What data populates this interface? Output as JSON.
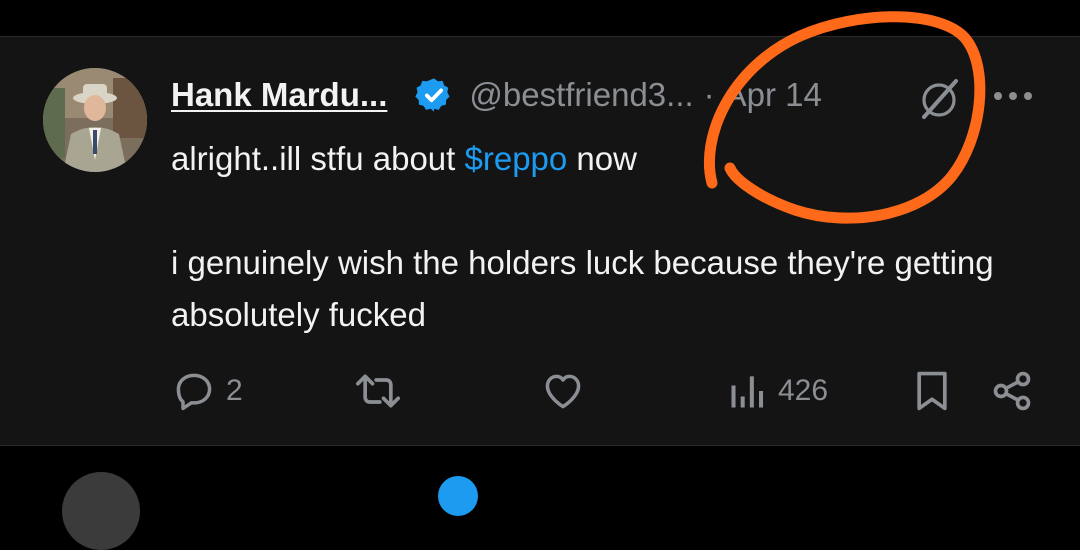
{
  "tweet": {
    "author_name": "Hank Mardu...",
    "handle": "@bestfriend3...",
    "separator": "·",
    "date": "Apr 14",
    "body_line1_prefix": "alright..ill stfu about ",
    "cashtag": "$reppo",
    "body_line1_suffix": " now",
    "body_line2": "i genuinely wish the holders luck because they're getting absolutely fucked",
    "replies": "2",
    "views": "426"
  },
  "icons": {
    "verified": "verified-badge-icon",
    "grok": "grok-icon",
    "more": "more-dots-icon",
    "reply": "reply-icon",
    "retweet": "retweet-icon",
    "like": "like-heart-icon",
    "views": "views-bar-chart-icon",
    "bookmark": "bookmark-icon",
    "share": "share-icon"
  },
  "colors": {
    "background": "#000000",
    "card": "#141414",
    "text": "#f2f2f2",
    "muted": "#8b8f94",
    "accent": "#1d9bf0",
    "annotation": "#ff6a1a"
  }
}
